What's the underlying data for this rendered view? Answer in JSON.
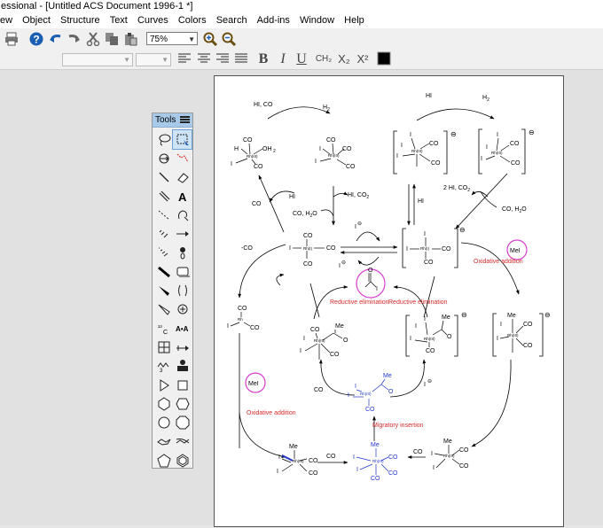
{
  "window": {
    "title": "essional - [Untitled ACS Document 1996-1 *]"
  },
  "menu": [
    "ew",
    "Object",
    "Structure",
    "Text",
    "Curves",
    "Colors",
    "Search",
    "Add-ins",
    "Window",
    "Help"
  ],
  "toolbar": {
    "zoom_value": "75%"
  },
  "format": {
    "bold": "B",
    "italic": "I",
    "underline": "U",
    "ch2": "CH₂",
    "subscript": "X₂",
    "superscript": "X²"
  },
  "tools_palette": {
    "title": "Tools",
    "items": [
      "lasso-icon",
      "marquee-icon",
      "structure-perspective-icon",
      "chain-icon",
      "bond-icon",
      "eraser-icon",
      "multiple-bond-icon",
      "text-icon",
      "dashed-bond-icon",
      "pen-icon",
      "hashed-bond-icon",
      "arrow-icon",
      "wedge-hash-icon",
      "orbital-icon",
      "bold-bond-icon",
      "rectangle-icon",
      "wedge-icon",
      "bracket-icon",
      "hollow-wedge-icon",
      "charge-icon",
      "mass-fragment-icon",
      "atom-map-icon",
      "table-icon",
      "reaction-icon",
      "ring-fragment-icon",
      "template-icon",
      "triangle-icon",
      "square-icon",
      "hexagon-icon",
      "hexagon-ring-icon",
      "circle-icon",
      "octagon-icon",
      "chair-icon",
      "chair-alt-icon",
      "pentagon-icon",
      "benzene-icon"
    ]
  },
  "diagram": {
    "labels": {
      "hi_co_top": "HI, CO",
      "h2_top": "H",
      "h2_sub": "2",
      "hi_top_right": "HI",
      "h2b": "H",
      "h": "H",
      "co": "CO",
      "oh2": "OH",
      "two": "2",
      "i": "I",
      "rh3": "Rh(III)",
      "rh1": "Rh(I)",
      "rh": "Rh",
      "hi_mid": "HI",
      "hi_co2": "HI, CO",
      "co_h2o": "CO, H",
      "o": "O",
      "two_hi_co2": "2 HI, CO",
      "co_h2o_right": "CO, H",
      "hi_arrow": "HI",
      "minus_co": "-CO",
      "mel": "MeI",
      "oxidative_addition": "Oxidative addition",
      "reductive_elimination": "Reductive elimination",
      "migratory_insertion": "Migratory insertion",
      "me": "Me",
      "theta": "⊖"
    }
  }
}
